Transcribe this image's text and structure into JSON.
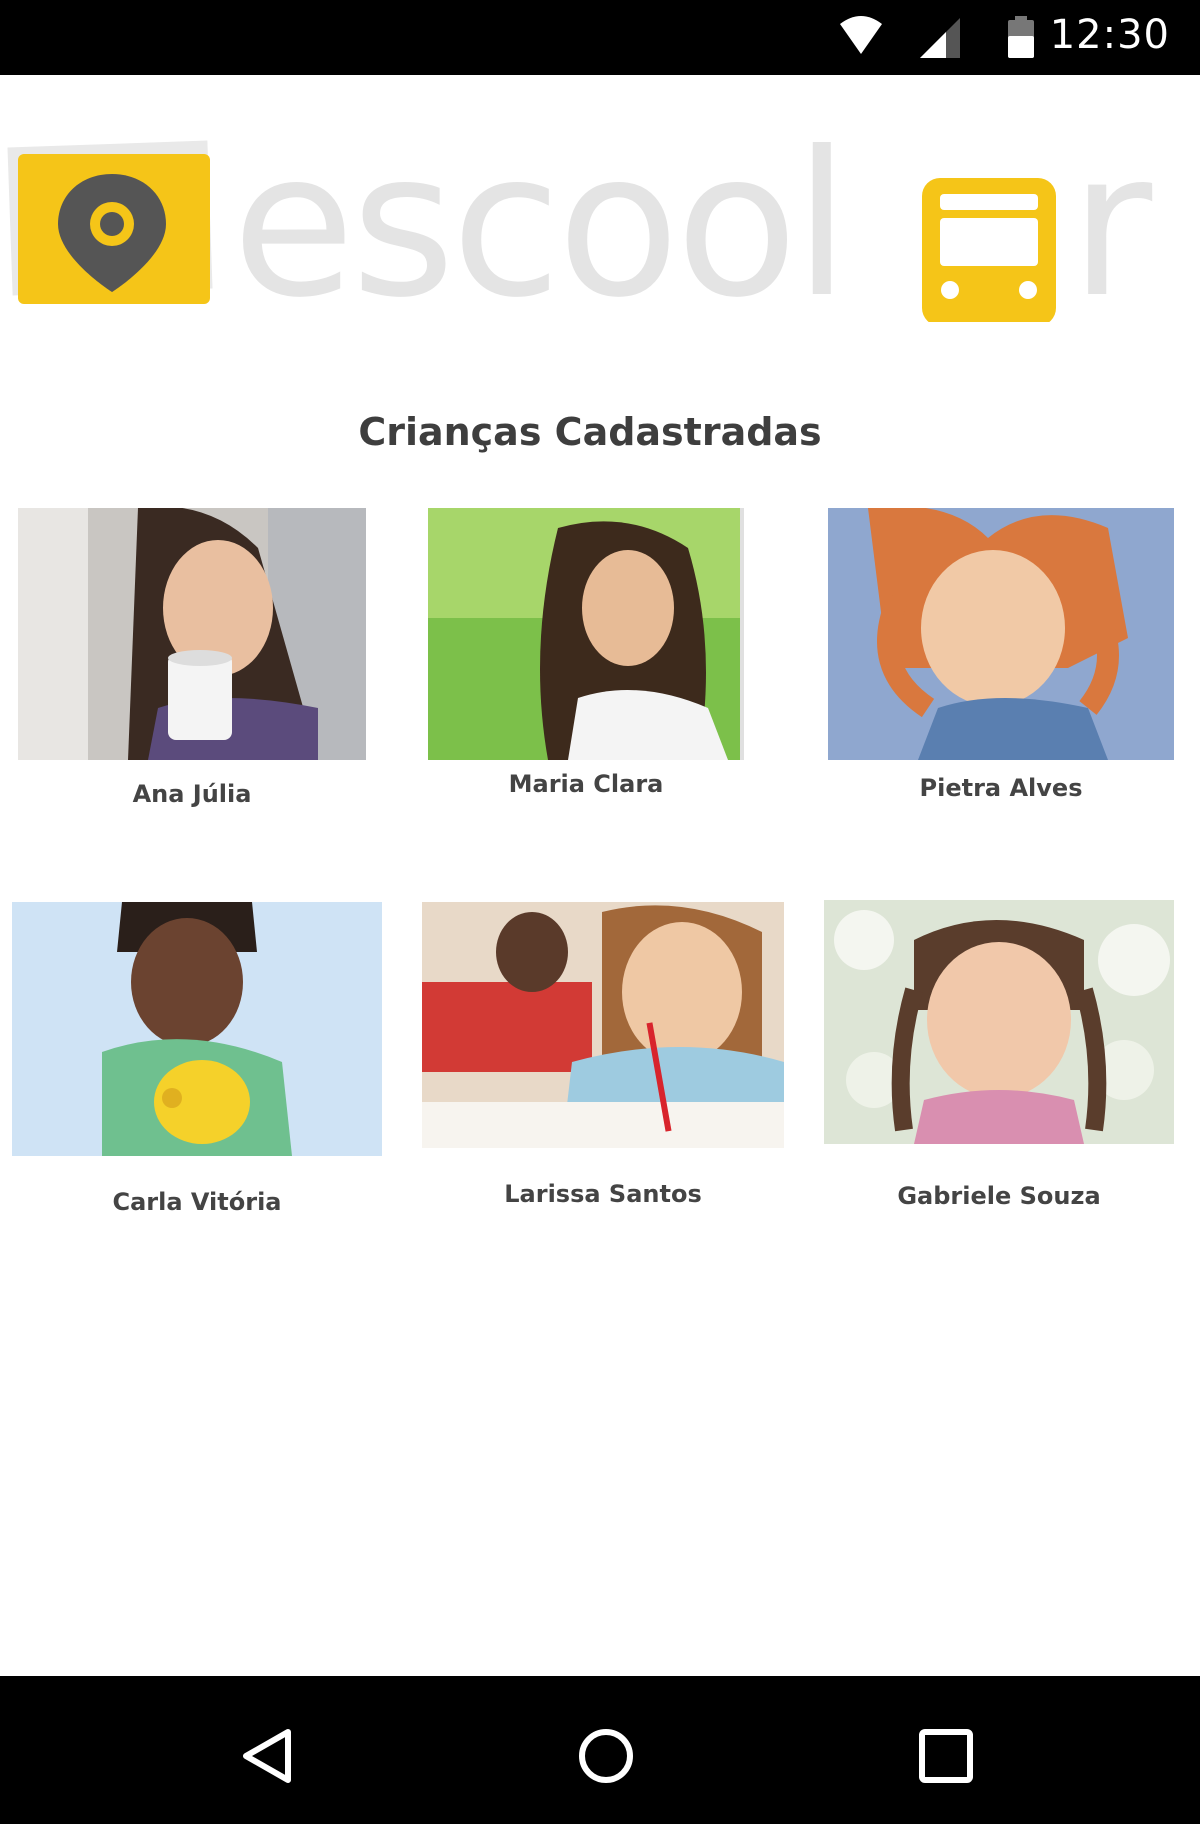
{
  "status_bar": {
    "time": "12:30",
    "icons": [
      "wifi-icon",
      "cell-signal-icon",
      "battery-icon"
    ]
  },
  "logo": {
    "text": "escoolar",
    "brand_color": "#F5C518",
    "text_color": "#E0E0E0",
    "pin_color": "#555555"
  },
  "page": {
    "title": "Crianças Cadastradas"
  },
  "children": [
    {
      "name": "Ana Júlia",
      "photo_theme": "girl-with-mug"
    },
    {
      "name": "Maria Clara",
      "photo_theme": "girl-curly-hair-grass"
    },
    {
      "name": "Pietra Alves",
      "photo_theme": "red-haired-girl-pigtails"
    },
    {
      "name": "Carla Vitória",
      "photo_theme": "girl-piggy-bank"
    },
    {
      "name": "Larissa Santos",
      "photo_theme": "girl-writing-classroom"
    },
    {
      "name": "Gabriele Souza",
      "photo_theme": "girl-braids-flowers"
    }
  ],
  "nav_bar": {
    "icons": [
      "back-icon",
      "home-icon",
      "recents-icon"
    ]
  }
}
